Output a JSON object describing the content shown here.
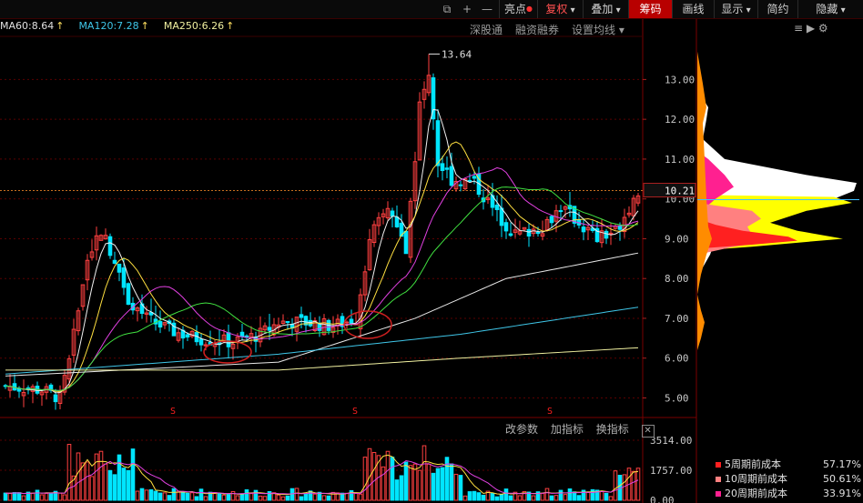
{
  "toolbar": {
    "icons": [
      "window-icon",
      "plus-icon",
      "minus-icon"
    ],
    "buttons": [
      {
        "label": "亮点",
        "dot": true
      },
      {
        "label": "复权",
        "arrow": true,
        "red": true
      },
      {
        "label": "叠加",
        "arrow": true
      },
      {
        "label": "筹码",
        "active": true
      },
      {
        "label": "画线"
      },
      {
        "label": "显示",
        "arrow": true
      },
      {
        "label": "简约"
      },
      {
        "label": "隐藏",
        "arrow": true
      }
    ],
    "arrow_glyph": "▾"
  },
  "ma_labels": [
    {
      "text": "MA60:8.64",
      "arrow": "↑",
      "color": "#e0e0e0"
    },
    {
      "text": "MA120:7.28",
      "arrow": "↑",
      "color": "#3fc6e8"
    },
    {
      "text": "MA250:6.26",
      "arrow": "↑",
      "color": "#f0f0a0"
    }
  ],
  "chart_links": [
    "深股通",
    "融资融券",
    "设置均线 ▾"
  ],
  "right_icons": "≡ ▶ ⚙",
  "price_axis": {
    "ticks": [
      "13.00",
      "12.00",
      "11.00",
      "10.00",
      "9.00",
      "8.00",
      "7.00",
      "6.00",
      "5.00"
    ],
    "current": "10.21",
    "min": 4.6,
    "max": 13.9
  },
  "high_marker": "13.64",
  "s_markers": [
    "S",
    "S",
    "S"
  ],
  "volume": {
    "ticks": [
      "3514.00",
      "1757.00",
      "0.00"
    ],
    "links": [
      "改参数",
      "加指标",
      "换指标"
    ],
    "close_glyph": "✕"
  },
  "legend": [
    {
      "label": "5周期前成本",
      "value": "57.17%",
      "color": "#ff2020"
    },
    {
      "label": "10周期前成本",
      "value": "50.61%",
      "color": "#ff8080"
    },
    {
      "label": "20周期前成本",
      "value": "33.91%",
      "color": "#ff2090"
    }
  ],
  "colors": {
    "up": "#ff4040",
    "down": "#00e5ff",
    "accent": "#b80000"
  }
}
